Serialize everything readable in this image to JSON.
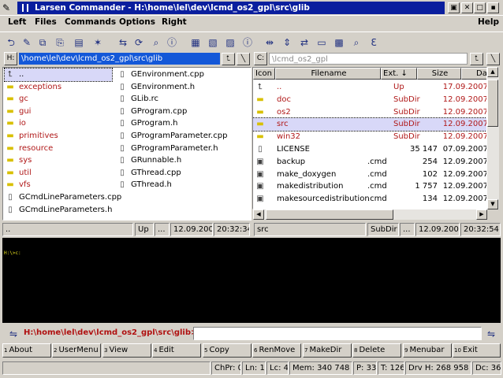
{
  "window": {
    "title": "Larsen Commander - H:\\home\\lel\\dev\\lcmd_os2_gpl\\src\\glib",
    "accent": "#0a1e9e"
  },
  "menu": {
    "left": "Left",
    "files": "Files",
    "commands": "Commands",
    "options": "Options",
    "right": "Right",
    "help": "Help"
  },
  "left_panel": {
    "drive": "H:",
    "path": "\\home\\lel\\dev\\lcmd_os2_gpl\\src\\glib",
    "col1": [
      {
        "name": "..",
        "icon": "up-arrow-icon"
      },
      {
        "name": "exceptions",
        "icon": "folder-icon"
      },
      {
        "name": "gc",
        "icon": "folder-icon"
      },
      {
        "name": "gui",
        "icon": "folder-icon"
      },
      {
        "name": "io",
        "icon": "folder-icon"
      },
      {
        "name": "primitives",
        "icon": "folder-icon"
      },
      {
        "name": "resource",
        "icon": "folder-icon"
      },
      {
        "name": "sys",
        "icon": "folder-icon"
      },
      {
        "name": "util",
        "icon": "folder-icon"
      },
      {
        "name": "vfs",
        "icon": "folder-icon"
      },
      {
        "name": "GCmdLineParameters.cpp",
        "icon": "file-icon"
      },
      {
        "name": "GCmdLineParameters.h",
        "icon": "file-icon"
      }
    ],
    "col2": [
      {
        "name": "GEnvironment.cpp"
      },
      {
        "name": "GEnvironment.h"
      },
      {
        "name": "GLib.rc"
      },
      {
        "name": "GProgram.cpp"
      },
      {
        "name": "GProgram.h"
      },
      {
        "name": "GProgramParameter.cpp"
      },
      {
        "name": "GProgramParameter.h"
      },
      {
        "name": "GRunnable.h"
      },
      {
        "name": "GThread.cpp"
      },
      {
        "name": "GThread.h"
      }
    ],
    "status": {
      "name": "..",
      "type": "Up",
      "dots": "...",
      "date": "12.09.2007",
      "time": "20:32:34"
    }
  },
  "right_panel": {
    "drive": "C:",
    "path": "\\lcmd_os2_gpl",
    "headers": {
      "icon": "Icon",
      "filename": "Filename",
      "ext": "Ext. ↓",
      "size": "Size",
      "date": "Date"
    },
    "rows": [
      {
        "icon": "up-arrow-icon",
        "name": "..",
        "ext": "",
        "size": "Up",
        "date": "17.09.2007",
        "dir": true
      },
      {
        "icon": "folder-icon",
        "name": "doc",
        "ext": "",
        "size": "SubDir",
        "date": "12.09.2007",
        "dir": true
      },
      {
        "icon": "folder-icon",
        "name": "os2",
        "ext": "",
        "size": "SubDir",
        "date": "12.09.2007",
        "dir": true
      },
      {
        "icon": "folder-icon",
        "name": "src",
        "ext": "",
        "size": "SubDir",
        "date": "12.09.2007",
        "dir": true
      },
      {
        "icon": "folder-icon",
        "name": "win32",
        "ext": "",
        "size": "SubDir",
        "date": "12.09.2007",
        "dir": true
      },
      {
        "icon": "file-icon",
        "name": "LICENSE",
        "ext": "",
        "size": "35 147",
        "date": "07.09.2007",
        "dir": false
      },
      {
        "icon": "cmd-file-icon",
        "name": "backup",
        "ext": ".cmd",
        "size": "254",
        "date": "12.09.2007",
        "dir": false
      },
      {
        "icon": "cmd-file-icon",
        "name": "make_doxygen",
        "ext": ".cmd",
        "size": "102",
        "date": "12.09.2007",
        "dir": false
      },
      {
        "icon": "cmd-file-icon",
        "name": "makedistribution",
        "ext": ".cmd",
        "size": "1 757",
        "date": "12.09.2007",
        "dir": false
      },
      {
        "icon": "cmd-file-icon",
        "name": "makesourcedistribution",
        "ext": ".cmd",
        "size": "134",
        "date": "12.09.2007",
        "dir": false
      }
    ],
    "status": {
      "name": "src",
      "type": "SubDir",
      "dots": "...",
      "date": "12.09.2007",
      "time": "20:32:54"
    }
  },
  "console": {
    "prompt": "H:\\>c:"
  },
  "cmdline": {
    "path": "H:\\home\\lel\\dev\\lcmd_os2_gpl\\src\\glib>",
    "value": ""
  },
  "fkeys": [
    {
      "n": "1",
      "label": "About"
    },
    {
      "n": "2",
      "label": "UserMenu"
    },
    {
      "n": "3",
      "label": "View"
    },
    {
      "n": "4",
      "label": "Edit"
    },
    {
      "n": "5",
      "label": "Copy"
    },
    {
      "n": "6",
      "label": "RenMove"
    },
    {
      "n": "7",
      "label": "MakeDir"
    },
    {
      "n": "8",
      "label": "Delete"
    },
    {
      "n": "9",
      "label": "Menubar"
    },
    {
      "n": "10",
      "label": "Exit"
    }
  ],
  "bottom_status": {
    "chpr": "ChPr: 0",
    "ln": "Ln: 1",
    "lc": "Lc: 4",
    "mem": "Mem: 340 748 K",
    "p": "P: 33",
    "t": "T: 126",
    "drv": "Drv H: 268 958 M",
    "dc": "Dc: 36"
  }
}
